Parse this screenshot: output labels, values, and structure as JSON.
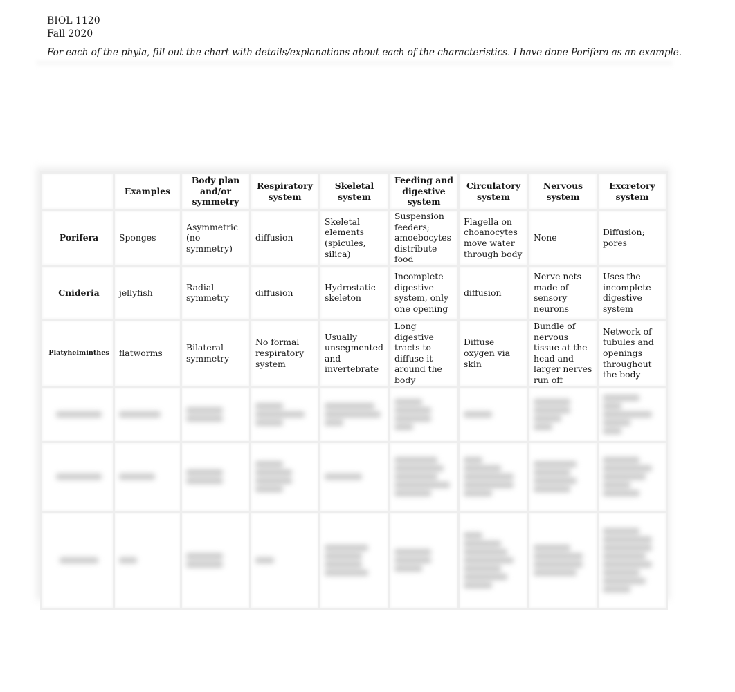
{
  "header": {
    "course": "BIOL 1120",
    "term": "Fall 2020",
    "instructions": "For each of the phyla, fill out the chart with details/explanations about each of the characteristics.  I have done Porifera as an example."
  },
  "table": {
    "columns": [
      "",
      "Examples",
      "Body plan and/or symmetry",
      "Respiratory system",
      "Skeletal system",
      "Feeding and digestive system",
      "Circulatory system",
      "Nervous system",
      "Excretory system"
    ],
    "rows": [
      {
        "phylum": "Porifera",
        "examples": "Sponges",
        "body_plan": "Asymmetric (no symmetry)",
        "respiratory": "diffusion",
        "skeletal": "Skeletal elements (spicules, silica)",
        "feeding": "Suspension feeders; amoebocytes distribute food",
        "circulatory": "Flagella on choanocytes move water through body",
        "nervous": "None",
        "excretory": "Diffusion; pores"
      },
      {
        "phylum": "Cnideria",
        "examples": "jellyfish",
        "body_plan": "Radial symmetry",
        "respiratory": "diffusion",
        "skeletal": "Hydrostatic skeleton",
        "feeding": "Incomplete digestive system, only one opening",
        "circulatory": "diffusion",
        "nervous": "Nerve nets made of sensory neurons",
        "excretory": "Uses the incomplete digestive system"
      },
      {
        "phylum": "Platyhelminthes",
        "examples": "flatworms",
        "body_plan": "Bilateral symmetry",
        "respiratory": "No formal respiratory system",
        "skeletal": "Usually unsegmented and invertebrate",
        "feeding": "Long digestive tracts to diffuse it around the body",
        "circulatory": "Diffuse oxygen via skin",
        "nervous": "Bundle of nervous tissue at the head and larger nerves run off",
        "excretory": "Network of tubules and openings throughout the body"
      }
    ],
    "blurred_rows_count": 3
  }
}
